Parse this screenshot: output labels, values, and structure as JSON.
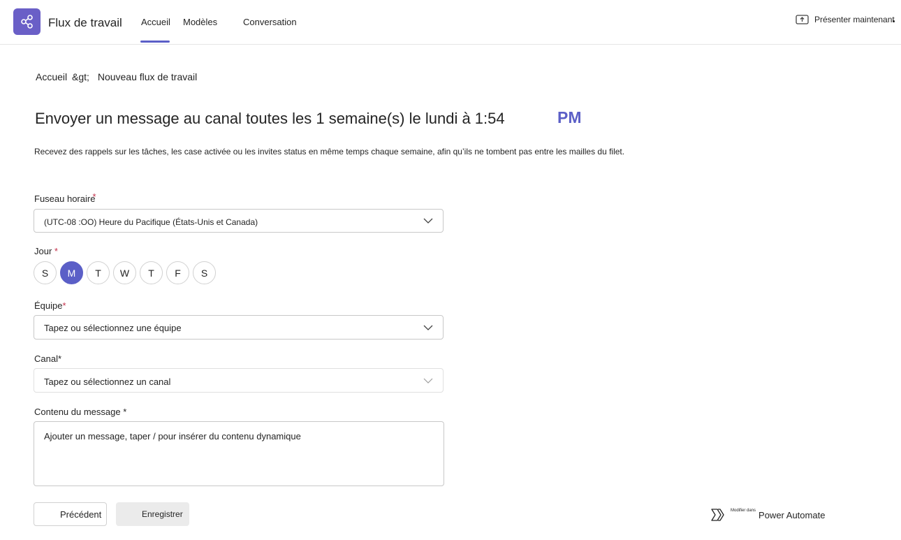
{
  "app": {
    "title": "Flux de travail",
    "icon": "share-nodes-icon",
    "accent": "#5b5fc7"
  },
  "tabs": [
    {
      "label": "Accueil",
      "active": true
    },
    {
      "label": "Modèles",
      "active": false
    },
    {
      "label": "Conversation",
      "active": false
    }
  ],
  "header": {
    "present_label": "Présenter maintenant",
    "present_icon": "share-screen-icon"
  },
  "breadcrumb": {
    "home": "Accueil",
    "separator": "&gt;",
    "current": "Nouveau flux de travail"
  },
  "page": {
    "title": "Envoyer un message au canal toutes les 1 semaine(s) le lundi à 1:54",
    "title_suffix": "PM",
    "description": "Recevez des rappels sur les tâches, les case activée ou les invites status en même temps chaque semaine, afin qu’ils ne tombent pas entre les mailles du filet."
  },
  "form": {
    "timezone": {
      "label": "Fuseau horaire",
      "required_mark": "*",
      "value": "(UTC-08 :OO) Heure du Pacifique (États-Unis et Canada)"
    },
    "day": {
      "label": "Jour",
      "required_mark": "*",
      "options": [
        "S",
        "M",
        "T",
        "W",
        "T",
        "F",
        "S"
      ],
      "selected": "M"
    },
    "team": {
      "label": "Équipe",
      "required_mark": "*",
      "placeholder": "Tapez ou sélectionnez une équipe"
    },
    "channel": {
      "label": "Canal*",
      "placeholder": "Tapez ou sélectionnez un canal"
    },
    "message": {
      "label": "Contenu du message *",
      "placeholder": "Ajouter un message, taper / pour insérer du contenu dynamique"
    }
  },
  "footer": {
    "back_label": "Précédent",
    "save_label": "Enregistrer",
    "edit_in_small": "Modifier dans",
    "edit_in_product": "Power Automate",
    "edit_icon": "power-automate-icon"
  }
}
